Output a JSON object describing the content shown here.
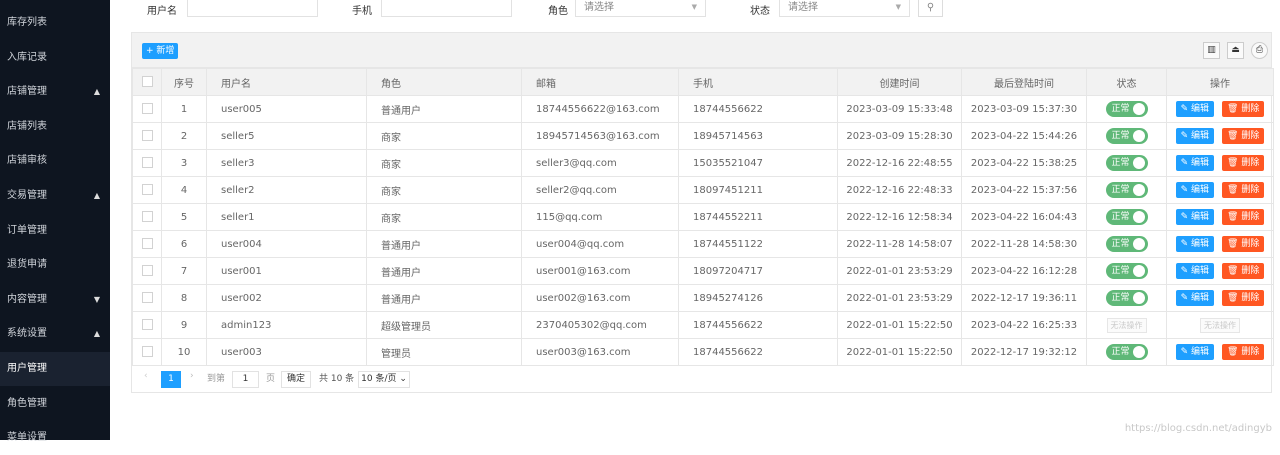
{
  "sidebar": {
    "items": [
      {
        "label": "库存列表"
      },
      {
        "label": "入库记录"
      },
      {
        "label": "店铺管理",
        "arrow": "▲"
      },
      {
        "label": "店铺列表"
      },
      {
        "label": "店铺审核"
      },
      {
        "label": "交易管理",
        "arrow": "▲"
      },
      {
        "label": "订单管理"
      },
      {
        "label": "退货申请"
      },
      {
        "label": "内容管理",
        "arrow": "▼"
      },
      {
        "label": "系统设置",
        "arrow": "▲"
      },
      {
        "label": "用户管理",
        "active": true
      },
      {
        "label": "角色管理"
      },
      {
        "label": "菜单设置"
      }
    ]
  },
  "filters": {
    "username_label": "用户名",
    "phone_label": "手机",
    "role_label": "角色",
    "role_placeholder": "请选择",
    "status_label": "状态",
    "status_placeholder": "请选择"
  },
  "toolbar": {
    "add_label": "+ 新增"
  },
  "table": {
    "headers": [
      "序号",
      "用户名",
      "角色",
      "邮箱",
      "手机",
      "创建时间",
      "最后登陆时间",
      "状态",
      "操作"
    ],
    "status_on": "正常",
    "edit_label": "✎ 编辑",
    "delete_label": "🗑 删除",
    "disabled_label": "无法操作",
    "rows": [
      [
        "1",
        "user005",
        "普通用户",
        "18744556622@163.com",
        "18744556622",
        "2023-03-09 15:33:48",
        "2023-03-09 15:37:30",
        true
      ],
      [
        "2",
        "seller5",
        "商家",
        "18945714563@163.com",
        "18945714563",
        "2023-03-09 15:28:30",
        "2023-04-22 15:44:26",
        true
      ],
      [
        "3",
        "seller3",
        "商家",
        "seller3@qq.com",
        "15035521047",
        "2022-12-16 22:48:55",
        "2023-04-22 15:38:25",
        true
      ],
      [
        "4",
        "seller2",
        "商家",
        "seller2@qq.com",
        "18097451211",
        "2022-12-16 22:48:33",
        "2023-04-22 15:37:56",
        true
      ],
      [
        "5",
        "seller1",
        "商家",
        "115@qq.com",
        "18744552211",
        "2022-12-16 12:58:34",
        "2023-04-22 16:04:43",
        true
      ],
      [
        "6",
        "user004",
        "普通用户",
        "user004@qq.com",
        "18744551122",
        "2022-11-28 14:58:07",
        "2022-11-28 14:58:30",
        true
      ],
      [
        "7",
        "user001",
        "普通用户",
        "user001@163.com",
        "18097204717",
        "2022-01-01 23:53:29",
        "2023-04-22 16:12:28",
        true
      ],
      [
        "8",
        "user002",
        "普通用户",
        "user002@163.com",
        "18945274126",
        "2022-01-01 23:53:29",
        "2022-12-17 19:36:11",
        true
      ],
      [
        "9",
        "admin123",
        "超级管理员",
        "2370405302@qq.com",
        "18744556622",
        "2022-01-01 15:22:50",
        "2023-04-22 16:25:33",
        false
      ],
      [
        "10",
        "user003",
        "管理员",
        "user003@163.com",
        "18744556622",
        "2022-01-01 15:22:50",
        "2022-12-17 19:32:12",
        true
      ]
    ]
  },
  "pager": {
    "current": "1",
    "goto_label": "到第",
    "page_value": "1",
    "page_label": "页",
    "confirm_label": "确定",
    "total_label": "共 10 条",
    "size_label": "10 条/页 ⌄"
  },
  "watermark": "https://blog.csdn.net/adingyb"
}
